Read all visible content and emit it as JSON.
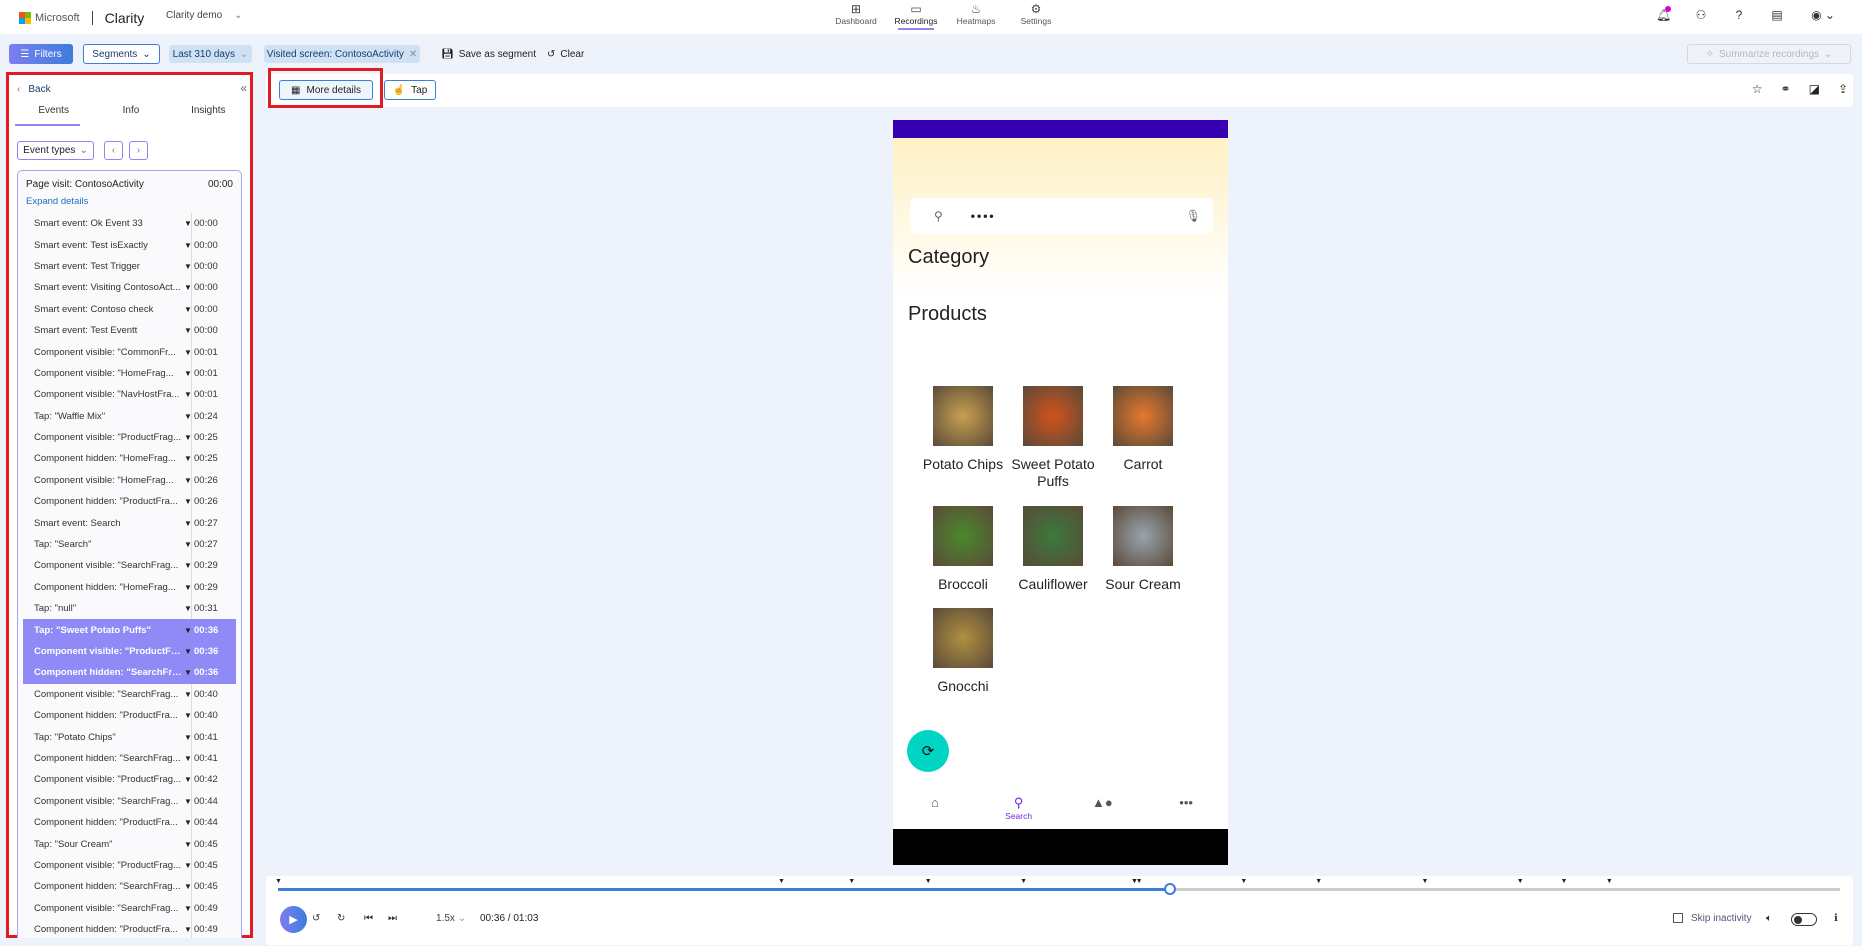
{
  "header": {
    "brand": "Microsoft",
    "app_title": "Clarity",
    "project": "Clarity demo",
    "nav": [
      {
        "label": "Dashboard",
        "icon": "dashboard-icon",
        "glyph": "⊞",
        "active": false
      },
      {
        "label": "Recordings",
        "icon": "video-icon",
        "glyph": "▭",
        "active": true
      },
      {
        "label": "Heatmaps",
        "icon": "flame-icon",
        "glyph": "♨",
        "active": false
      },
      {
        "label": "Settings",
        "icon": "gear-icon",
        "glyph": "⚙",
        "active": false
      }
    ],
    "right_icons": [
      {
        "name": "notifications-icon",
        "glyph": "🔔︎"
      },
      {
        "name": "share-users-icon",
        "glyph": "⚇"
      },
      {
        "name": "help-icon",
        "glyph": "?"
      },
      {
        "name": "document-icon",
        "glyph": "▤"
      },
      {
        "name": "account-icon",
        "glyph": "◉ ⌄"
      }
    ]
  },
  "toolbar": {
    "filters": "Filters",
    "segments": "Segments",
    "date_range": "Last 310 days",
    "visited_chip": "Visited screen: ContosoActivity",
    "save_segment": "Save as segment",
    "clear": "Clear",
    "summarize": "Summarize recordings"
  },
  "sidebar": {
    "back": "Back",
    "tabs": [
      "Events",
      "Info",
      "Insights"
    ],
    "active_tab": "Events",
    "event_types": "Event types",
    "page_visit": {
      "label": "Page visit: ContosoActivity",
      "time": "00:00"
    },
    "expand": "Expand details",
    "events": [
      {
        "label": "Smart event: Ok Event 33",
        "time": "00:00"
      },
      {
        "label": "Smart event: Test isExactly",
        "time": "00:00"
      },
      {
        "label": "Smart event: Test Trigger",
        "time": "00:00"
      },
      {
        "label": "Smart event: Visiting ContosoAct...",
        "time": "00:00"
      },
      {
        "label": "Smart event: Contoso check",
        "time": "00:00"
      },
      {
        "label": "Smart event: Test Eventt",
        "time": "00:00"
      },
      {
        "label": "Component visible: \"CommonFr...",
        "time": "00:01"
      },
      {
        "label": "Component visible: \"HomeFrag...",
        "time": "00:01"
      },
      {
        "label": "Component visible: \"NavHostFra...",
        "time": "00:01"
      },
      {
        "label": "Tap: \"Waffle Mix\"",
        "time": "00:24"
      },
      {
        "label": "Component visible: \"ProductFrag...",
        "time": "00:25"
      },
      {
        "label": "Component hidden: \"HomeFrag...",
        "time": "00:25"
      },
      {
        "label": "Component visible: \"HomeFrag...",
        "time": "00:26"
      },
      {
        "label": "Component hidden: \"ProductFra...",
        "time": "00:26"
      },
      {
        "label": "Smart event: Search",
        "time": "00:27"
      },
      {
        "label": "Tap: \"Search\"",
        "time": "00:27"
      },
      {
        "label": "Component visible: \"SearchFrag...",
        "time": "00:29"
      },
      {
        "label": "Component hidden: \"HomeFrag...",
        "time": "00:29"
      },
      {
        "label": "Tap: \"null\"",
        "time": "00:31"
      },
      {
        "label": "Tap: \"Sweet Potato Puffs\"",
        "time": "00:36",
        "selected": true
      },
      {
        "label": "Component visible: \"ProductFra...",
        "time": "00:36",
        "selected": true
      },
      {
        "label": "Component hidden: \"SearchFra...",
        "time": "00:36",
        "selected": true
      },
      {
        "label": "Component visible: \"SearchFrag...",
        "time": "00:40"
      },
      {
        "label": "Component hidden: \"ProductFra...",
        "time": "00:40"
      },
      {
        "label": "Tap: \"Potato Chips\"",
        "time": "00:41"
      },
      {
        "label": "Component hidden: \"SearchFrag...",
        "time": "00:41"
      },
      {
        "label": "Component visible: \"ProductFrag...",
        "time": "00:42"
      },
      {
        "label": "Component visible: \"SearchFrag...",
        "time": "00:44"
      },
      {
        "label": "Component hidden: \"ProductFra...",
        "time": "00:44"
      },
      {
        "label": "Tap: \"Sour Cream\"",
        "time": "00:45"
      },
      {
        "label": "Component visible: \"ProductFrag...",
        "time": "00:45"
      },
      {
        "label": "Component hidden: \"SearchFrag...",
        "time": "00:45"
      },
      {
        "label": "Component visible: \"SearchFrag...",
        "time": "00:49"
      },
      {
        "label": "Component hidden: \"ProductFra...",
        "time": "00:49"
      }
    ]
  },
  "main": {
    "more_details": "More details",
    "tap": "Tap"
  },
  "phone": {
    "search_text": "••••",
    "category": "Category",
    "products_title": "Products",
    "products": [
      {
        "name": "Potato Chips",
        "color": "#c8a050"
      },
      {
        "name": "Sweet Potato Puffs",
        "color": "#d2521c"
      },
      {
        "name": "Carrot",
        "color": "#e8782c"
      },
      {
        "name": "Broccoli",
        "color": "#4a8a2a"
      },
      {
        "name": "Cauliflower",
        "color": "#3a7a3a"
      },
      {
        "name": "Sour Cream",
        "color": "#9aa4ac"
      },
      {
        "name": "Gnocchi",
        "color": "#b09040"
      }
    ],
    "bottom_nav_active": "Search"
  },
  "player": {
    "progress": 0.571,
    "markers": [
      0.0,
      0.322,
      0.367,
      0.416,
      0.477,
      0.548,
      0.551,
      0.548,
      0.618,
      0.666,
      0.734,
      0.795,
      0.823,
      0.852
    ],
    "speed": "1.5x",
    "time": "00:36 / 01:03",
    "skip_inactivity": "Skip inactivity"
  }
}
